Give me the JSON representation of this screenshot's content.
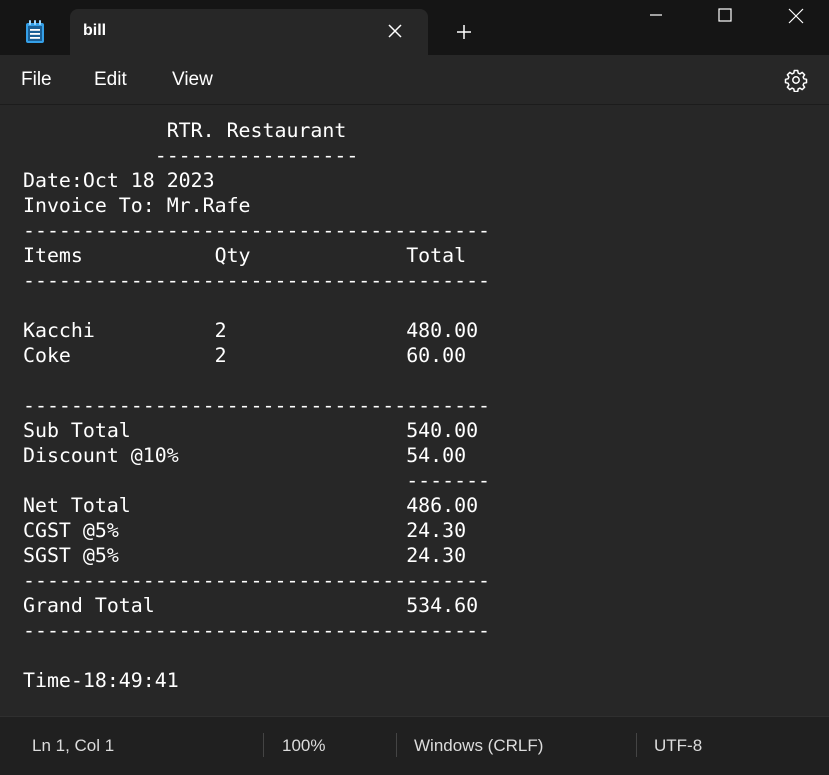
{
  "window": {
    "tab_title": "bill",
    "icons": {
      "app": "notepad-icon",
      "close_tab": "close-icon",
      "new_tab": "plus-icon",
      "minimize": "minimize-icon",
      "maximize": "maximize-icon",
      "close": "close-icon"
    }
  },
  "menu": {
    "file": "File",
    "edit": "Edit",
    "view": "View",
    "settings_icon": "gear-icon"
  },
  "document": {
    "lines": [
      "            RTR. Restaurant",
      "           -----------------",
      "Date:Oct 18 2023",
      "Invoice To: Mr.Rafe",
      "---------------------------------------",
      "Items           Qty             Total",
      "---------------------------------------",
      "",
      "Kacchi          2               480.00",
      "Coke            2               60.00",
      "",
      "---------------------------------------",
      "Sub Total                       540.00",
      "Discount @10%                   54.00",
      "                                -------",
      "Net Total                       486.00",
      "CGST @5%                        24.30",
      "SGST @5%                        24.30",
      "---------------------------------------",
      "Grand Total                     534.60",
      "---------------------------------------",
      "",
      "Time-18:49:41"
    ]
  },
  "status": {
    "position": "Ln 1, Col 1",
    "zoom": "100%",
    "line_ending": "Windows (CRLF)",
    "encoding": "UTF-8"
  },
  "colors": {
    "titlebar": "#151515",
    "editor_bg": "#272727",
    "text": "#ffffff",
    "app_icon": "#4cc2ff"
  }
}
